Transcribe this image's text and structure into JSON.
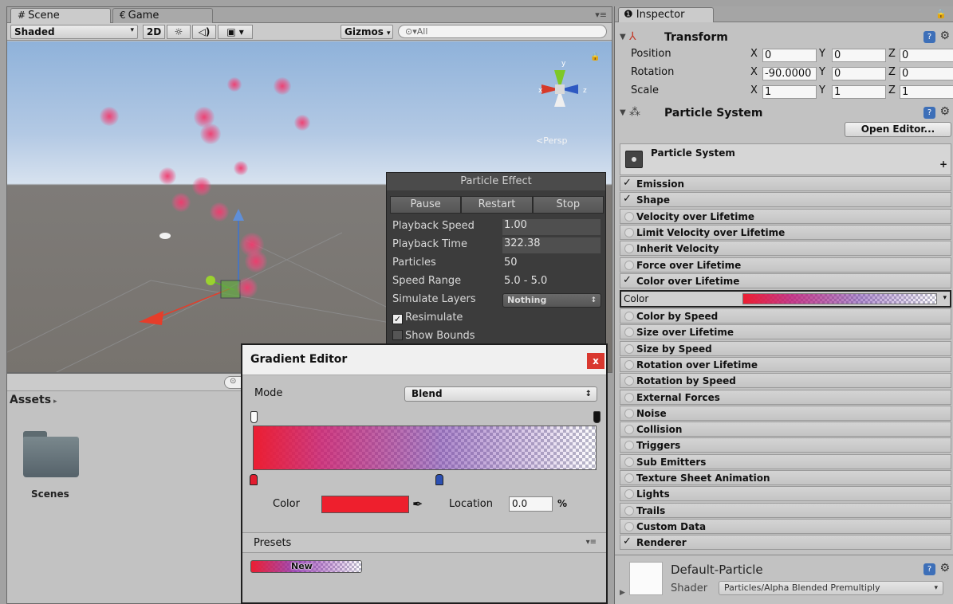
{
  "scene": {
    "tabs": [
      {
        "label": "Scene",
        "icon": "#"
      },
      {
        "label": "Game",
        "icon": "€"
      }
    ],
    "toolbar": {
      "shading": "Shaded",
      "mode_2d": "2D",
      "gizmos": "Gizmos",
      "search": "All"
    },
    "orientation_label": "Persp"
  },
  "particle_effect": {
    "title": "Particle Effect",
    "buttons": [
      "Pause",
      "Restart",
      "Stop"
    ],
    "rows": [
      {
        "label": "Playback Speed",
        "value": "1.00"
      },
      {
        "label": "Playback Time",
        "value": "322.38"
      },
      {
        "label": "Particles",
        "value": "50"
      },
      {
        "label": "Speed Range",
        "value": "5.0 - 5.0"
      }
    ],
    "simulate_layers_label": "Simulate Layers",
    "simulate_layers_value": "Nothing",
    "resimulate_label": "Resimulate",
    "resimulate_checked": true,
    "show_bounds_label": "Show Bounds",
    "show_bounds_checked": false
  },
  "project": {
    "assets_label": "Assets",
    "folders": [
      {
        "name": "Scenes"
      }
    ]
  },
  "gradient_editor": {
    "title": "Gradient Editor",
    "close": "x",
    "mode_label": "Mode",
    "mode_value": "Blend",
    "color_label": "Color",
    "color_value": "#ee1f2d",
    "location_label": "Location",
    "location_value": "0.0",
    "location_unit": "%",
    "presets_label": "Presets",
    "preset_text": "New"
  },
  "inspector": {
    "tab_label": "Inspector",
    "transform": {
      "title": "Transform",
      "rows": [
        {
          "label": "Position",
          "x": "0",
          "y": "0",
          "z": "0"
        },
        {
          "label": "Rotation",
          "x": "-90.0000",
          "y": "0",
          "z": "0"
        },
        {
          "label": "Scale",
          "x": "1",
          "y": "1",
          "z": "1"
        }
      ]
    },
    "particle_system": {
      "title": "Particle System",
      "open_editor": "Open Editor...",
      "panel_label": "Particle System"
    },
    "modules": [
      {
        "label": "Emission",
        "enabled": true
      },
      {
        "label": "Shape",
        "enabled": true
      },
      {
        "label": "Velocity over Lifetime",
        "enabled": false
      },
      {
        "label": "Limit Velocity over Lifetime",
        "enabled": false
      },
      {
        "label": "Inherit Velocity",
        "enabled": false
      },
      {
        "label": "Force over Lifetime",
        "enabled": false
      },
      {
        "label": "Color over Lifetime",
        "enabled": true
      }
    ],
    "color_row_label": "Color",
    "modules_after": [
      {
        "label": "Color by Speed",
        "enabled": false
      },
      {
        "label": "Size over Lifetime",
        "enabled": false
      },
      {
        "label": "Size by Speed",
        "enabled": false
      },
      {
        "label": "Rotation over Lifetime",
        "enabled": false
      },
      {
        "label": "Rotation by Speed",
        "enabled": false
      },
      {
        "label": "External Forces",
        "enabled": false
      },
      {
        "label": "Noise",
        "enabled": false
      },
      {
        "label": "Collision",
        "enabled": false
      },
      {
        "label": "Triggers",
        "enabled": false
      },
      {
        "label": "Sub Emitters",
        "enabled": false
      },
      {
        "label": "Texture Sheet Animation",
        "enabled": false
      },
      {
        "label": "Lights",
        "enabled": false
      },
      {
        "label": "Trails",
        "enabled": false
      },
      {
        "label": "Custom Data",
        "enabled": false
      },
      {
        "label": "Renderer",
        "enabled": true
      }
    ],
    "material": {
      "name": "Default-Particle",
      "shader_label": "Shader",
      "shader_value": "Particles/Alpha Blended Premultiply"
    }
  }
}
